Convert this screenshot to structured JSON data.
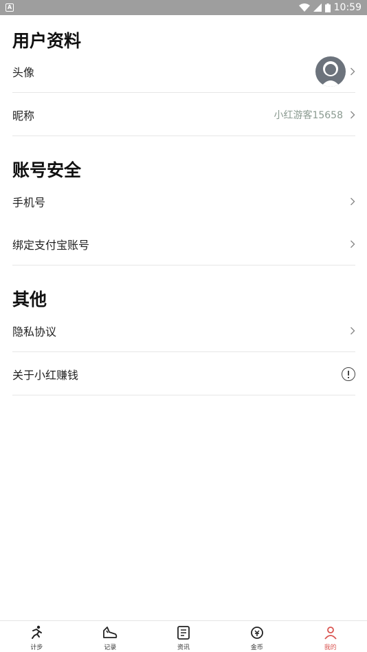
{
  "status_bar": {
    "time": "10:59",
    "notification_glyph": "A"
  },
  "sections": [
    {
      "title": "用户资料"
    },
    {
      "title": "账号安全"
    },
    {
      "title": "其他"
    }
  ],
  "profile": {
    "avatar_label": "头像",
    "nickname_label": "昵称",
    "nickname_value": "小红游客15658"
  },
  "security": {
    "phone_label": "手机号",
    "alipay_label": "绑定支付宝账号"
  },
  "other": {
    "privacy_label": "隐私协议",
    "about_label": "关于小红赚钱"
  },
  "tabs": [
    {
      "label": "计步",
      "icon": "running-icon"
    },
    {
      "label": "记录",
      "icon": "shoe-icon"
    },
    {
      "label": "资讯",
      "icon": "news-icon"
    },
    {
      "label": "金币",
      "icon": "coin-icon"
    },
    {
      "label": "我的",
      "icon": "profile-icon"
    }
  ]
}
